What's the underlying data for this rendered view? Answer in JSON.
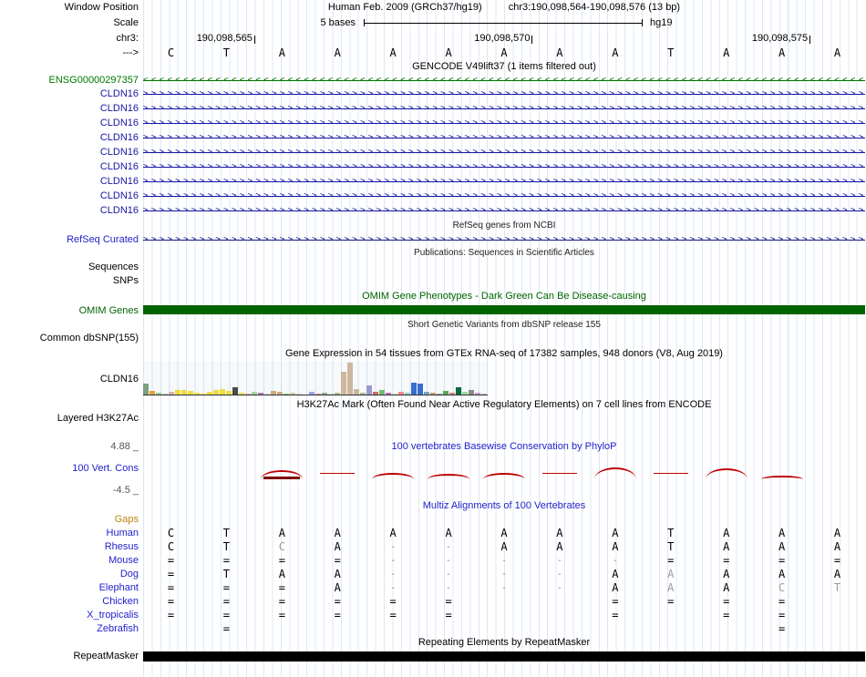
{
  "header": {
    "row_label": "Window Position",
    "assembly_title": "Human Feb. 2009 (GRCh37/hg19)",
    "position_title": "chr3:190,098,564-190,098,576 (13 bp)"
  },
  "scale_row": {
    "label": "Scale",
    "scale_text": "5 bases",
    "assembly_tag": "hg19"
  },
  "ruler": {
    "chrom_label": "chr3:",
    "strand_label": "--->",
    "tick_labels": [
      {
        "text": "190,098,565",
        "col": 1
      },
      {
        "text": "190,098,570",
        "col": 6
      },
      {
        "text": "190,098,575",
        "col": 11
      }
    ],
    "bases": [
      "C",
      "T",
      "A",
      "A",
      "A",
      "A",
      "A",
      "A",
      "A",
      "T",
      "A",
      "A",
      "A"
    ]
  },
  "gencode": {
    "title": "GENCODE V49lift37 (1 items filtered out)",
    "rows": [
      {
        "label": "ENSG00000297357",
        "color": "#007700",
        "arrow": "<"
      },
      {
        "label": "CLDN16",
        "color": "#1717a3",
        "arrow": ">"
      },
      {
        "label": "CLDN16",
        "color": "#1717a3",
        "arrow": ">"
      },
      {
        "label": "CLDN16",
        "color": "#1717a3",
        "arrow": ">"
      },
      {
        "label": "CLDN16",
        "color": "#1717a3",
        "arrow": ">"
      },
      {
        "label": "CLDN16",
        "color": "#1717a3",
        "arrow": ">"
      },
      {
        "label": "CLDN16",
        "color": "#1717a3",
        "arrow": ">"
      },
      {
        "label": "CLDN16",
        "color": "#1717a3",
        "arrow": ">"
      },
      {
        "label": "CLDN16",
        "color": "#1717a3",
        "arrow": ">"
      },
      {
        "label": "CLDN16",
        "color": "#1717a3",
        "arrow": ">"
      }
    ]
  },
  "refseq": {
    "title": "RefSeq genes from NCBI",
    "track_label": "RefSeq Curated",
    "color": "#15158a",
    "arrow": ">"
  },
  "publications": {
    "title": "Publications: Sequences in Scientific Articles",
    "track_labels": [
      "Sequences",
      "SNPs"
    ]
  },
  "omim": {
    "title": "OMIM Gene Phenotypes - Dark Green Can Be Disease-causing",
    "track_label": "OMIM Genes",
    "color": "#006400"
  },
  "dbsnp": {
    "title": "Short Genetic Variants from dbSNP release 155",
    "track_label": "Common dbSNP(155)"
  },
  "gtex": {
    "title": "Gene Expression in 54 tissues from GTEx RNA-seq of 17382 samples, 948 donors (V8, Aug 2019)",
    "gene_label": "CLDN16",
    "bars": [
      [
        12,
        "#7d9f7d"
      ],
      [
        4,
        "#e8a13c"
      ],
      [
        2,
        "#8fce8f"
      ],
      [
        1,
        "#c9c9c9"
      ],
      [
        3,
        "#d9b3b3"
      ],
      [
        5,
        "#efdd3e"
      ],
      [
        5,
        "#efdd3e"
      ],
      [
        4,
        "#efdd3e"
      ],
      [
        2,
        "#efdd3e"
      ],
      [
        1,
        "#efdd3e"
      ],
      [
        3,
        "#efdd3e"
      ],
      [
        5,
        "#efdd3e"
      ],
      [
        6,
        "#efdd3e"
      ],
      [
        4,
        "#efdd3e"
      ],
      [
        8,
        "#4a4a4a"
      ],
      [
        2,
        "#efdd3e"
      ],
      [
        1,
        "#d8a7a7"
      ],
      [
        3,
        "#9fd49f"
      ],
      [
        2,
        "#b07ab0"
      ],
      [
        1,
        "#d9d9d9"
      ],
      [
        4,
        "#cdaa7d"
      ],
      [
        3,
        "#cdaa7d"
      ],
      [
        1,
        "#7ccc7c"
      ],
      [
        2,
        "#cccc99"
      ],
      [
        1,
        "#f2c6c6"
      ],
      [
        0,
        "#ffffff"
      ],
      [
        3,
        "#a3a3e8"
      ],
      [
        1,
        "#cf8f8f"
      ],
      [
        2,
        "#8fb38f"
      ],
      [
        1,
        "#d0d0d0"
      ],
      [
        2,
        "#b8b878"
      ],
      [
        25,
        "#cdb79e"
      ],
      [
        35,
        "#cdb79e"
      ],
      [
        6,
        "#c9b999"
      ],
      [
        2,
        "#a8bb88"
      ],
      [
        10,
        "#9a9ad1"
      ],
      [
        3,
        "#cc6b6b"
      ],
      [
        5,
        "#6fbf6f"
      ],
      [
        2,
        "#c86bc8"
      ],
      [
        1,
        "#dede9a"
      ],
      [
        3,
        "#f28b8b"
      ],
      [
        2,
        "#8fcccc"
      ],
      [
        13,
        "#3b6ecc"
      ],
      [
        12,
        "#3b6ecc"
      ],
      [
        3,
        "#7aa5cc"
      ],
      [
        2,
        "#cc9a66"
      ],
      [
        1,
        "#a0a0a0"
      ],
      [
        4,
        "#57a857"
      ],
      [
        2,
        "#dd7b7b"
      ],
      [
        8,
        "#0a6b3c"
      ],
      [
        3,
        "#9add9a"
      ],
      [
        5,
        "#8a8a8a"
      ],
      [
        2,
        "#cc9acc"
      ],
      [
        1,
        "#c0c0c0"
      ]
    ]
  },
  "encode": {
    "title": "H3K27Ac Mark (Often Found Near Active Regulatory Elements) on 7 cell lines from ENCODE",
    "track_label": "Layered H3K27Ac"
  },
  "conservation": {
    "title": "100 vertebrates Basewise Conservation by PhyloP",
    "track_label": "100 Vert. Cons",
    "axis_max": "4.88 _",
    "axis_min": "-4.5 _",
    "color": "#c00000",
    "peaks": [
      {
        "col": 2,
        "type": "hill",
        "h": 10,
        "fill": true
      },
      {
        "col": 3,
        "type": "flat"
      },
      {
        "col": 4,
        "type": "hill",
        "h": 7
      },
      {
        "col": 5,
        "type": "hill",
        "h": 6
      },
      {
        "col": 6,
        "type": "hill",
        "h": 7
      },
      {
        "col": 7,
        "type": "flat"
      },
      {
        "col": 8,
        "type": "hill",
        "h": 13
      },
      {
        "col": 9,
        "type": "flat"
      },
      {
        "col": 10,
        "type": "hill",
        "h": 12
      },
      {
        "col": 11,
        "type": "hill",
        "h": 4
      }
    ]
  },
  "multiz": {
    "title": "Multiz Alignments of 100 Vertebrates",
    "gaps_label": "Gaps",
    "species": [
      {
        "name": "Human",
        "cells": [
          "C",
          "T",
          "A",
          "A",
          "A",
          "A",
          "A",
          "A",
          "A",
          "T",
          "A",
          "A",
          "A"
        ],
        "gray": []
      },
      {
        "name": "Rhesus",
        "cells": [
          "C",
          "T",
          "C",
          "A",
          "-",
          "-",
          "A",
          "A",
          "A",
          "T",
          "A",
          "A",
          "A"
        ],
        "gray": [
          2
        ]
      },
      {
        "name": "Mouse",
        "cells": [
          "=",
          "=",
          "=",
          "=",
          "-",
          "-",
          "-",
          "-",
          "-",
          "=",
          "=",
          "=",
          "="
        ],
        "gray": []
      },
      {
        "name": "Dog",
        "cells": [
          "=",
          "T",
          "A",
          "A",
          "-",
          "-",
          "-",
          "-",
          "A",
          "A",
          "A",
          "A",
          "A"
        ],
        "gray": [
          9
        ]
      },
      {
        "name": "Elephant",
        "cells": [
          "=",
          "=",
          "=",
          "A",
          "-",
          "-",
          "-",
          "-",
          "A",
          "A",
          "A",
          "C",
          "T"
        ],
        "gray": [
          9,
          11,
          12
        ]
      },
      {
        "name": "Chicken",
        "cells": [
          "=",
          "=",
          "=",
          "=",
          "=",
          "=",
          "",
          "",
          "=",
          "=",
          "=",
          "=",
          ""
        ],
        "gray": []
      },
      {
        "name": "X_tropicalis",
        "cells": [
          "=",
          "=",
          "=",
          "=",
          "=",
          "=",
          "",
          "",
          "=",
          "",
          "=",
          "=",
          ""
        ],
        "gray": []
      },
      {
        "name": "Zebrafish",
        "cells": [
          "",
          "=",
          "",
          "",
          "",
          "",
          "",
          "",
          "",
          "",
          "",
          "=",
          ""
        ],
        "gray": []
      }
    ]
  },
  "repeatmasker": {
    "title": "Repeating Elements by RepeatMasker",
    "track_label": "RepeatMasker",
    "color": "#000000"
  },
  "colors": {
    "label_blue": "#2222cc",
    "gene_green": "#007700",
    "gene_navy": "#1717a3",
    "omim_dark_green": "#006400",
    "conservation_red": "#c00000",
    "gaps_orange": "#b8860b",
    "guideline_blue": "#dce8f4"
  }
}
